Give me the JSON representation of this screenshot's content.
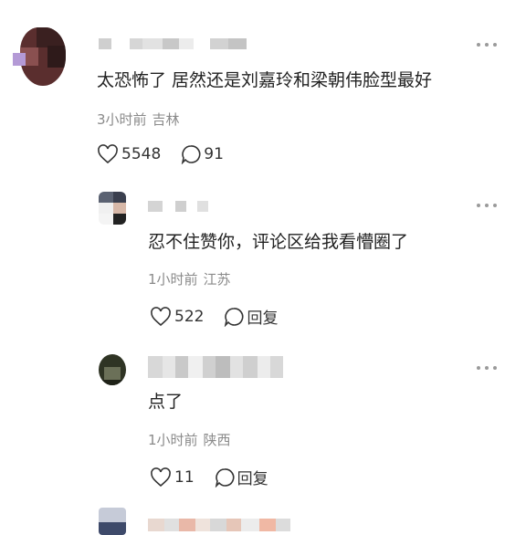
{
  "comments": [
    {
      "text": "太恐怖了 居然还是刘嘉玲和梁朝伟脸型最好",
      "time": "3小时前",
      "location": "吉林",
      "likes": "5548",
      "replies": "91",
      "avatar_colors": [
        "#6e3a3a",
        "#3b2424",
        "#9b6b6b",
        "#c9a0a0"
      ]
    },
    {
      "text": "忍不住赞你，评论区给我看懵圈了",
      "time": "1小时前",
      "location": "江苏",
      "likes": "522",
      "reply_label": "回复",
      "avatar_colors": [
        "#5b6272",
        "#e8e8e8",
        "#3a3a3a",
        "#c4a798"
      ]
    },
    {
      "text": "点了",
      "time": "1小时前",
      "location": "陕西",
      "likes": "11",
      "reply_label": "回复",
      "avatar_colors": [
        "#2f3424",
        "#6b7058",
        "#1f2218",
        "#8a8c76"
      ]
    }
  ]
}
